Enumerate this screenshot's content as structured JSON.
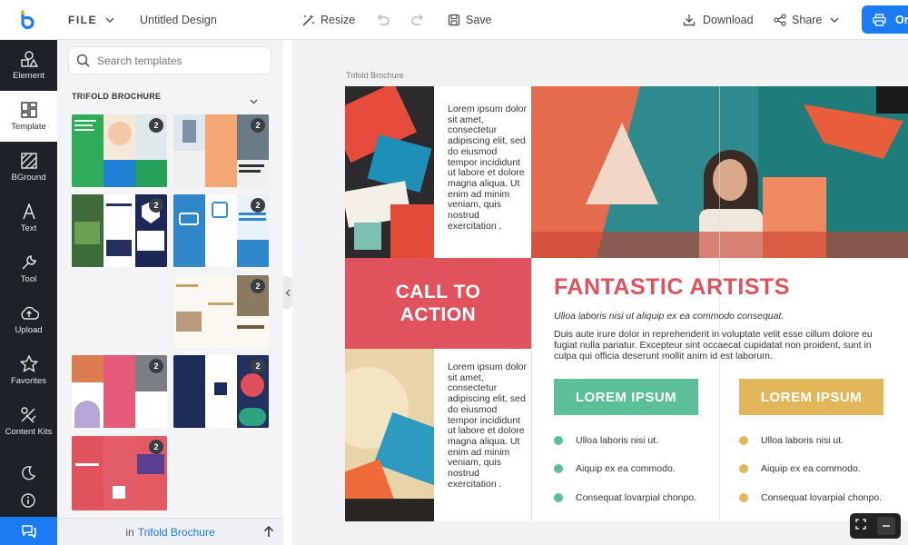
{
  "header": {
    "file_label": "FILE",
    "doc_title": "Untitled Design",
    "resize_label": "Resize",
    "save_label": "Save",
    "download_label": "Download",
    "share_label": "Share",
    "order_label": "Or"
  },
  "nav": {
    "items": [
      {
        "label": "Element",
        "icon": "element-icon"
      },
      {
        "label": "Template",
        "icon": "template-icon"
      },
      {
        "label": "BGround",
        "icon": "background-icon"
      },
      {
        "label": "Text",
        "icon": "text-icon"
      },
      {
        "label": "Tool",
        "icon": "wrench-icon"
      },
      {
        "label": "Upload",
        "icon": "upload-icon"
      },
      {
        "label": "Favorites",
        "icon": "star-icon"
      },
      {
        "label": "Content Kits",
        "icon": "content-kits-icon"
      }
    ]
  },
  "panel": {
    "search_placeholder": "Search templates",
    "section_title": "TRIFOLD BROCHURE",
    "badge": "2",
    "footer_prefix": "in",
    "footer_category": "Trifold Brochure"
  },
  "canvas": {
    "page_label": "Trifold Brochure",
    "lorem_column": "Lorem ipsum dolor sit amet, consectetur adipiscing elit, sed do eiusmod tempor incididunt ut labore et dolore magna aliqua. Ut enim ad minim veniam, quis nostrud exercitation .",
    "cta_line1": "CALL TO",
    "cta_line2": "ACTION",
    "heading": "FANTASTIC ARTISTS",
    "subheading": "Ulloa laboris nisi ut aliquip ex ea commodo consequat.",
    "paragraph": "Duis aute irure dolor in reprehenderit in voluptate velit esse cillum dolore eu fugiat nulla pariatur. Excepteur sint occaecat cupidatat non proident, sunt in culpa qui officia deserunt mollit anim id est laborum.",
    "button_left": "LOREM IPSUM",
    "button_right": "LOREM IPSUM",
    "bullets": [
      "Ulloa laboris nisi ut.",
      "Aiquip ex ea commodo.",
      "Consequat lovarpial chonpo."
    ]
  },
  "colors": {
    "accent_blue": "#1a7bf2",
    "cta_red": "#e0525c",
    "button_green": "#5bbf98",
    "button_gold": "#e2b75a",
    "nav_dark": "#1e2127"
  }
}
